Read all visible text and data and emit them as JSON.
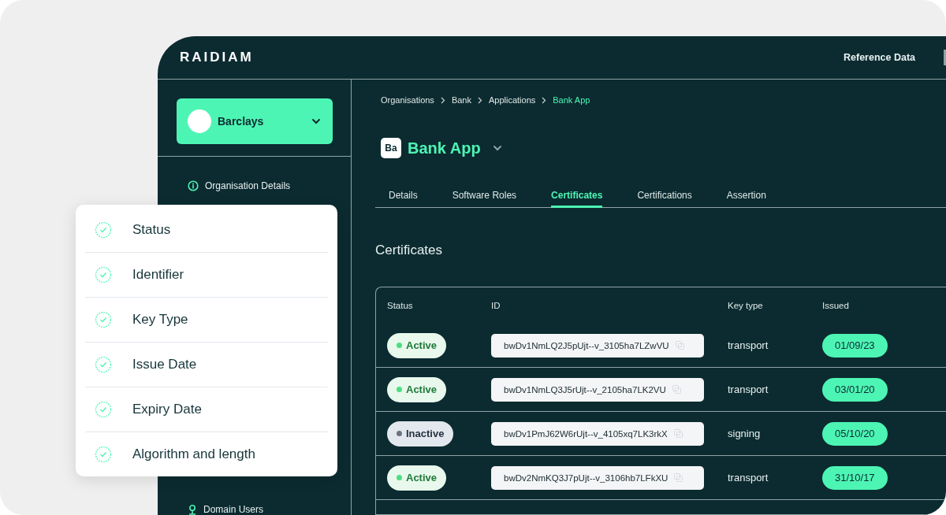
{
  "header": {
    "logo": "RAIDIAM",
    "links": [
      "Reference Data"
    ]
  },
  "org_selector": {
    "name": "Barclays"
  },
  "sidebar": {
    "items": [
      {
        "label": "Organisation Details",
        "kind": "info"
      },
      {
        "label": "Domain Users",
        "kind": "pin"
      }
    ]
  },
  "breadcrumb": [
    {
      "label": "Organisations",
      "current": false
    },
    {
      "label": "Bank",
      "current": false
    },
    {
      "label": "Applications",
      "current": false
    },
    {
      "label": "Bank App",
      "current": true
    }
  ],
  "app": {
    "badge": "Ba",
    "title": "Bank App"
  },
  "tabs": [
    {
      "label": "Details",
      "selected": false
    },
    {
      "label": "Software Roles",
      "selected": false
    },
    {
      "label": "Certificates",
      "selected": true
    },
    {
      "label": "Certifications",
      "selected": false
    },
    {
      "label": "Assertion",
      "selected": false
    }
  ],
  "section_title": "Certificates",
  "table": {
    "columns": [
      "Status",
      "ID",
      "Key type",
      "Issued"
    ],
    "rows": [
      {
        "status": "Active",
        "kind": "active",
        "id": "bwDv1NmLQ2J5pUjt--v_3105ha7LZwVU",
        "key_type": "transport",
        "issued": "01/09/23"
      },
      {
        "status": "Active",
        "kind": "active",
        "id": "bwDv1NmLQ3J5rUjt--v_2105ha7LK2VU",
        "key_type": "transport",
        "issued": "03/01/20"
      },
      {
        "status": "Inactive",
        "kind": "inactive",
        "id": "bwDv1PmJ62W6rUjt--v_4105xq7LK3rkX",
        "key_type": "signing",
        "issued": "05/10/20"
      },
      {
        "status": "Active",
        "kind": "active",
        "id": "bwDv2NmKQ3J7pUjt--v_3106hb7LFkXU",
        "key_type": "transport",
        "issued": "31/10/17"
      }
    ]
  },
  "checklist": [
    {
      "label": "Status"
    },
    {
      "label": "Identifier"
    },
    {
      "label": "Key Type"
    },
    {
      "label": "Issue Date"
    },
    {
      "label": "Expiry Date"
    },
    {
      "label": "Algorithm and length"
    }
  ]
}
